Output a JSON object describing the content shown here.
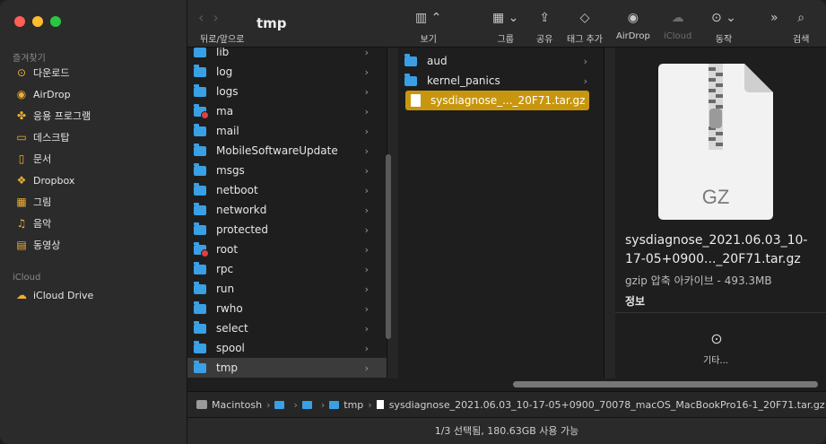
{
  "window": {
    "title": "tmp"
  },
  "toolbar": {
    "back_forward_label": "뒤로/앞으로",
    "view_label": "보기",
    "group_label": "그룹",
    "share_label": "공유",
    "tags_label": "태그 추가",
    "airdrop_label": "AirDrop",
    "icloud_label": "iCloud",
    "action_label": "동작",
    "search_label": "검색"
  },
  "sidebar": {
    "favorites_header": "즐겨찾기",
    "favorites": [
      {
        "label": "다운로드",
        "icon": "download-icon",
        "glyph": "⊙"
      },
      {
        "label": "AirDrop",
        "icon": "airdrop-icon",
        "glyph": "◉"
      },
      {
        "label": "응용 프로그램",
        "icon": "applications-icon",
        "glyph": "✤"
      },
      {
        "label": "데스크탑",
        "icon": "desktop-icon",
        "glyph": "▭"
      },
      {
        "label": "문서",
        "icon": "document-icon",
        "glyph": "▯"
      },
      {
        "label": "Dropbox",
        "icon": "dropbox-icon",
        "glyph": "❖"
      },
      {
        "label": "그림",
        "icon": "pictures-icon",
        "glyph": "▦"
      },
      {
        "label": "음악",
        "icon": "music-icon",
        "glyph": "♫"
      },
      {
        "label": "동영상",
        "icon": "movies-icon",
        "glyph": "▤"
      }
    ],
    "icloud_header": "iCloud",
    "icloud": [
      {
        "label": "iCloud Drive",
        "icon": "icloud-drive-icon",
        "glyph": "☁"
      }
    ]
  },
  "column1": {
    "items": [
      {
        "label": "lib",
        "noaccess": false
      },
      {
        "label": "log",
        "noaccess": false
      },
      {
        "label": "logs",
        "noaccess": false
      },
      {
        "label": "ma",
        "noaccess": true
      },
      {
        "label": "mail",
        "noaccess": false
      },
      {
        "label": "MobileSoftwareUpdate",
        "noaccess": false
      },
      {
        "label": "msgs",
        "noaccess": false
      },
      {
        "label": "netboot",
        "noaccess": false
      },
      {
        "label": "networkd",
        "noaccess": false
      },
      {
        "label": "protected",
        "noaccess": false
      },
      {
        "label": "root",
        "noaccess": true
      },
      {
        "label": "rpc",
        "noaccess": false
      },
      {
        "label": "run",
        "noaccess": false
      },
      {
        "label": "rwho",
        "noaccess": false
      },
      {
        "label": "select",
        "noaccess": false
      },
      {
        "label": "spool",
        "noaccess": false
      },
      {
        "label": "tmp",
        "noaccess": false
      }
    ],
    "selected": "tmp"
  },
  "column2": {
    "items": [
      {
        "label": "aud",
        "type": "folder"
      },
      {
        "label": "kernel_panics",
        "type": "folder"
      },
      {
        "label": "sysdiagnose_..._20F71.tar.gz",
        "type": "file"
      }
    ],
    "selected": "sysdiagnose_..._20F71.tar.gz"
  },
  "preview": {
    "file_badge": "GZ",
    "name": "sysdiagnose_2021.06.03_10-17-05+0900..._20F71.tar.gz",
    "kind_size": "gzip 압축 아카이브 - 493.3MB",
    "info_label": "정보",
    "more_label": "기타..."
  },
  "pathbar": {
    "segments": [
      "Macintosh",
      "",
      "",
      "tmp",
      "sysdiagnose_2021.06.03_10-17-05+0900_70078_macOS_MacBookPro16-1_20F71.tar.gz"
    ]
  },
  "status": {
    "text": "1/3 선택됨, 180.63GB 사용 가능"
  },
  "colors": {
    "accent": "#c8960e",
    "folder": "#3aa0e6",
    "sidebar_icon": "#f0b030"
  }
}
